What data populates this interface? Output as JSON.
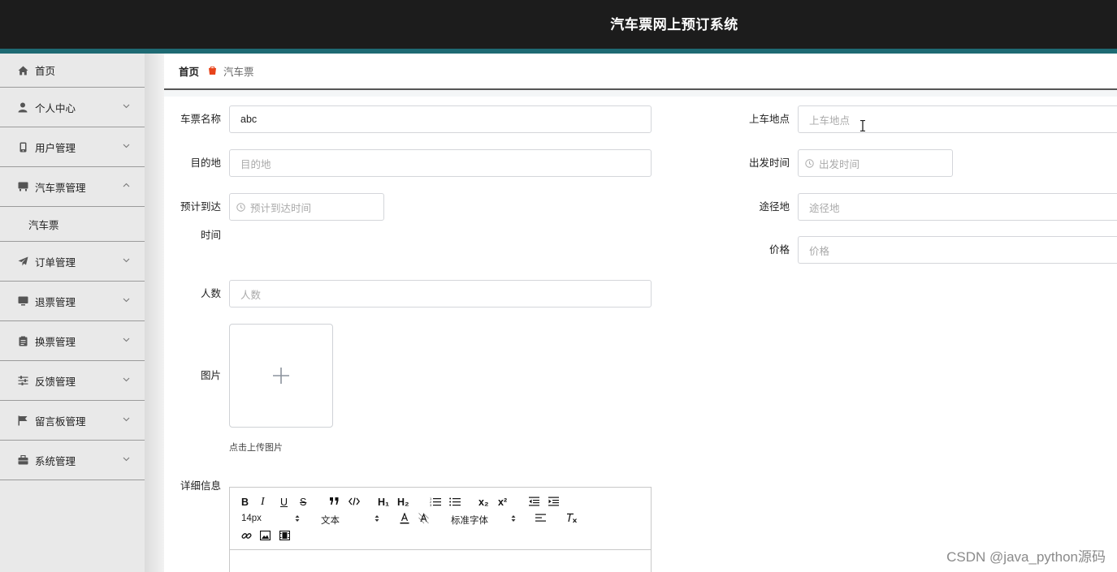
{
  "header": {
    "title": "汽车票网上预订系统"
  },
  "sidebar": {
    "items": [
      {
        "label": "首页",
        "icon": "home-icon"
      },
      {
        "label": "个人中心",
        "icon": "user-icon"
      },
      {
        "label": "用户管理",
        "icon": "phone-icon"
      },
      {
        "label": "汽车票管理",
        "icon": "bus-ticket-icon",
        "expanded": true,
        "children": [
          {
            "label": "汽车票"
          }
        ]
      },
      {
        "label": "订单管理",
        "icon": "paper-plane-icon"
      },
      {
        "label": "退票管理",
        "icon": "monitor-icon"
      },
      {
        "label": "换票管理",
        "icon": "clipboard-icon"
      },
      {
        "label": "反馈管理",
        "icon": "sliders-icon"
      },
      {
        "label": "留言板管理",
        "icon": "flag-icon"
      },
      {
        "label": "系统管理",
        "icon": "briefcase-icon"
      }
    ]
  },
  "breadcrumb": {
    "home": "首页",
    "current": "汽车票"
  },
  "form": {
    "name": {
      "label": "车票名称",
      "value": "abc"
    },
    "boarding": {
      "label": "上车地点",
      "placeholder": "上车地点"
    },
    "destination": {
      "label": "目的地",
      "placeholder": "目的地"
    },
    "departure": {
      "label": "出发时间",
      "placeholder": "出发时间"
    },
    "arrival": {
      "label_line1": "预计到达",
      "label_line2": "时间",
      "placeholder": "预计到达时间"
    },
    "via": {
      "label": "途径地",
      "placeholder": "途径地"
    },
    "price": {
      "label": "价格",
      "placeholder": "价格"
    },
    "people": {
      "label": "人数",
      "placeholder": "人数"
    },
    "image": {
      "label": "图片",
      "hint": "点击上传图片"
    },
    "detail": {
      "label": "详细信息",
      "toolbar": {
        "bold": "B",
        "italic": "I",
        "underline": "U",
        "strike": "S",
        "h1": "H₁",
        "h2": "H₂",
        "sub": "x₂",
        "sup": "x²",
        "size": "14px",
        "paragraph": "文本",
        "font": "标准字体"
      }
    }
  },
  "watermark": "CSDN @java_python源码",
  "colors": {
    "header_bg": "#1c1c1c",
    "accent": "#1e6a73",
    "breadcrumb_sep": "#e8431a"
  }
}
